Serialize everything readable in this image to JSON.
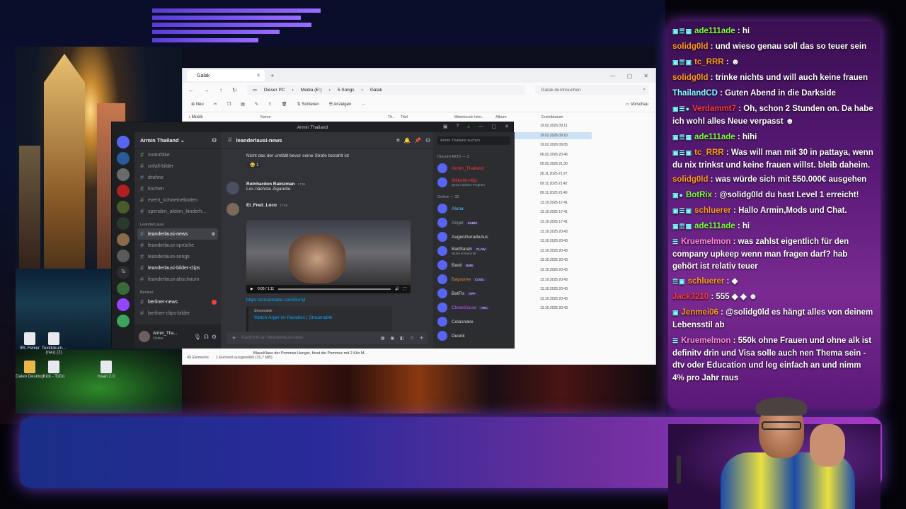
{
  "explorer": {
    "tab_title": "Galak",
    "nav_path": [
      "Dieser PC",
      "Media (E:)",
      "5 Songs",
      "Galak"
    ],
    "search_placeholder": "Galak durchsuchen",
    "toolbar": {
      "new": "Neu",
      "sort": "Sortieren",
      "view": "Anzeigen",
      "preview": "Vorschau"
    },
    "sidebar_first": "Musik",
    "columns": [
      "Name",
      "Tit..",
      "Titel",
      "Mitwirkende Inter...",
      "Album",
      "Erstelldatum"
    ],
    "dates": [
      "19.02.2026 09:11",
      "19.02.2026 09:10",
      "19.02.2026 09:05",
      "06.02.2026 20:46",
      "05.02.2026 21:30",
      "26.11.2025 21:27",
      "09.11.2025 21:42",
      "09.11.2025 21:40",
      "13.10.2025 17:41",
      "13.10.2025 17:41",
      "13.10.2025 17:41",
      "13.10.2025 20:43",
      "13.10.2025 20:43",
      "13.10.2025 20:43",
      "13.10.2025 20:43",
      "13.10.2025 20:43",
      "13.10.2025 20:43",
      "13.10.2025 20:43",
      "13.10.2025 20:43",
      "13.10.2025 20:43"
    ],
    "status_items": "49 Elemente",
    "status_selected": "1 Element ausgewählt (16,7 MB)",
    "selected_file": "BlaueKlaus der Pommes Hengst, frisst die Pommes mit 2 Kilo M..."
  },
  "discord": {
    "window_title": "Armin Thailand",
    "guild_name": "Armin Thailand",
    "channels_top": [
      "motorbike",
      "unfall-bilder",
      "drohne",
      "kochen",
      "event_schweinebraten",
      "spenden_aktion_kinderh..."
    ],
    "category_1": "LeanderLausi",
    "channels_mid": [
      "leanderlausi-news",
      "leanderlausi-sprüche",
      "leanderlausi-songs",
      "leanderlausi-bilder-clips",
      "leanderlausi-abschaum"
    ],
    "category_2": "Berliner",
    "channels_bottom": [
      "berliner-news",
      "berliner-clips-bilder"
    ],
    "user_name": "Armin_Tha...",
    "user_status": "Online",
    "channel_header": "leanderlausi-news",
    "messages": [
      {
        "text": "Nicht das der umfällt bevor seine Strafe bezahlt ist",
        "reaction": "1"
      },
      {
        "author": "Reinhardon Rainzman",
        "time": "17:51",
        "text": "Los nächste Zigarette"
      },
      {
        "author": "El_Fred_Loco",
        "time": "17:56"
      }
    ],
    "video_time": "0:00 / 1:11",
    "link": "https://streamable.com/5orfyl",
    "embed_provider": "Streamable",
    "embed_title": "Watch Ärger im Paradies | Streamable",
    "input_placeholder": "Nachricht an #leanderlausi-news",
    "member_search": "Armin Thailand suchen",
    "group_mod": "Discord-MOD — 2",
    "mods": [
      {
        "name": "Armin_Thailand",
        "color": "#ff3a3a"
      },
      {
        "name": "Mitkohlo-Kip",
        "color": "#ff3a3a",
        "sub": "Dyson Sphere Program"
      }
    ],
    "group_online": "Online — 30",
    "members": [
      {
        "name": "Aluna",
        "color": "#5bc0ff"
      },
      {
        "name": "Angel",
        "badge": "SUBM",
        "color": "#949ba4"
      },
      {
        "name": "AugenGeradeAus",
        "color": "#dbdee1"
      },
      {
        "name": "BadSarah",
        "badge": "CLAW",
        "sub": "World of Warcraft",
        "color": "#dbdee1"
      },
      {
        "name": "Basti",
        "badge": "BoBi",
        "color": "#dbdee1"
      },
      {
        "name": "Baysome",
        "badge": "COOL",
        "color": "#d68a3a"
      },
      {
        "name": "BotFix",
        "badge": "APP",
        "color": "#dbdee1"
      },
      {
        "name": "CloneSouse",
        "badge": "ARC",
        "color": "#c55cff"
      },
      {
        "name": "Colasnake",
        "color": "#dbdee1"
      },
      {
        "name": "Deorik",
        "color": "#dbdee1"
      }
    ]
  },
  "desktop_icons": [
    "IRL Fehler",
    "Textdokum... (neu) (2)",
    "Daten Desktop",
    "Kick - ToDo",
    "Issan 2.0"
  ],
  "chat": [
    {
      "badges": "▣☰▦",
      "user": "ade111ade",
      "color": "#7dff3a",
      "text": " : hi"
    },
    {
      "badges": "",
      "user": "solidg0ld",
      "color": "#ff9a1e",
      "text": " : und wieso genau soll das so teuer sein"
    },
    {
      "badges": "▣☰▣",
      "user": "tc_RRR",
      "color": "#ff9a1e",
      "text": " : ☻"
    },
    {
      "badges": "",
      "user": "solidg0ld",
      "color": "#ff9a1e",
      "text": " : trinke nichts und will auch keine frauen"
    },
    {
      "badges": "",
      "user": "ThailandCD",
      "color": "#7dffff",
      "text": " : Guten Abend in die Darkside"
    },
    {
      "badges": "▣☰●",
      "user": "Verdammt7",
      "color": "#ff3a3a",
      "text": " : Oh, schon 2 Stunden on. Da habe ich wohl alles Neue verpasst ☻"
    },
    {
      "badges": "▣☰▦",
      "user": "ade111ade",
      "color": "#7dff3a",
      "text": " : hihi"
    },
    {
      "badges": "▣☰▣",
      "user": "tc_RRR",
      "color": "#ff9a1e",
      "text": " : Was will man mit 30 in pattaya, wenn du nix trinkst und keine frauen willst. bleib daheim."
    },
    {
      "badges": "",
      "user": "solidg0ld",
      "color": "#ff9a1e",
      "text": " : was würde sich mit 550.000€ ausgehen"
    },
    {
      "badges": "▣●",
      "user": "BotRix",
      "color": "#7dff3a",
      "text": " : @solidg0ld du hast Level 1 erreicht!"
    },
    {
      "badges": "▣☰▣",
      "user": "schluerer",
      "color": "#ff9a1e",
      "text": " : Hallo Armin,Mods und Chat."
    },
    {
      "badges": "▣☰▦",
      "user": "ade111ade",
      "color": "#7dff3a",
      "text": " : hi"
    },
    {
      "badges": "☰",
      "user": "Kruemelmon",
      "color": "#ff8ad8",
      "text": " : was zahlst eigentlich für den company upkeep wenn man fragen darf? hab gehört ist relativ teuer"
    },
    {
      "badges": "☰▣",
      "user": "schluerer",
      "color": "#ff9a1e",
      "text": " : ◆"
    },
    {
      "badges": "",
      "user": "Jack3210",
      "color": "#ff3a3a",
      "text": " : 555 ◆ ◆ ☻"
    },
    {
      "badges": "▣",
      "user": "Jenmei06",
      "color": "#ff9a1e",
      "text": " : @solidg0ld es hängt alles von deinem Lebensstil ab"
    },
    {
      "badges": "☰",
      "user": "Kruemelmon",
      "color": "#ff8ad8",
      "text": " : 550k ohne Frauen und ohne alk ist definitv drin und Visa solle auch nen Thema sein - dtv oder Education und leg einfach an und nimm 4% pro Jahr raus"
    }
  ]
}
